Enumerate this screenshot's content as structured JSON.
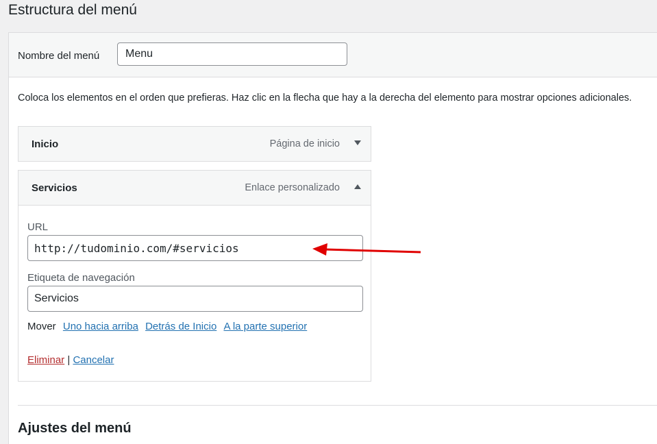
{
  "page": {
    "title": "Estructura del menú"
  },
  "menu_name": {
    "label": "Nombre del menú",
    "value": "Menu"
  },
  "instructions": "Coloca los elementos en el orden que prefieras. Haz clic en la flecha que hay a la derecha del elemento para mostrar opciones adicionales.",
  "items": [
    {
      "title": "Inicio",
      "type": "Página de inicio",
      "expanded": false
    },
    {
      "title": "Servicios",
      "type": "Enlace personalizado",
      "expanded": true,
      "url_label": "URL",
      "url_value": "http://tudominio.com/#servicios",
      "nav_label_label": "Etiqueta de navegación",
      "nav_label_value": "Servicios",
      "move_label": "Mover",
      "move_links": [
        "Uno hacia arriba",
        "Detrás de Inicio",
        "A la parte superior"
      ],
      "delete_label": "Eliminar",
      "separator": "|",
      "cancel_label": "Cancelar"
    }
  ],
  "settings_title": "Ajustes del menú",
  "colors": {
    "link": "#2271b1",
    "delete": "#b32d2e",
    "annotation_arrow": "#e00000"
  }
}
